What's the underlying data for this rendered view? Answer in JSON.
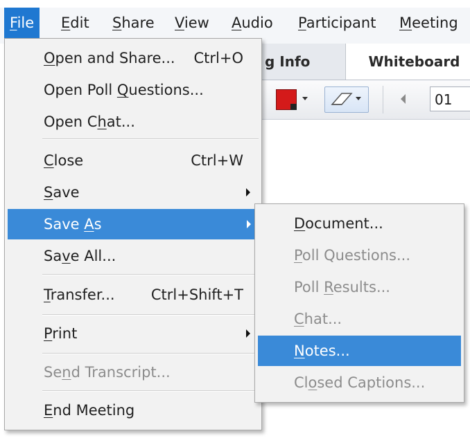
{
  "menubar": {
    "items": [
      {
        "pre": "",
        "u": "F",
        "post": "ile"
      },
      {
        "pre": "",
        "u": "E",
        "post": "dit"
      },
      {
        "pre": "",
        "u": "S",
        "post": "hare"
      },
      {
        "pre": "",
        "u": "V",
        "post": "iew"
      },
      {
        "pre": "",
        "u": "A",
        "post": "udio"
      },
      {
        "pre": "",
        "u": "P",
        "post": "articipant"
      },
      {
        "pre": "",
        "u": "M",
        "post": "eeting"
      }
    ]
  },
  "tabs": {
    "meeting_info": "g Info",
    "whiteboard": "Whiteboard"
  },
  "toolbar": {
    "page_value": "01"
  },
  "file_menu": {
    "open_share": {
      "pre": "",
      "u": "O",
      "post": "pen and Share...",
      "shortcut": "Ctrl+O"
    },
    "open_poll": {
      "pre": "Open Poll ",
      "u": "Q",
      "post": "uestions..."
    },
    "open_chat": {
      "pre": "Open C",
      "u": "h",
      "post": "at..."
    },
    "close": {
      "pre": "",
      "u": "C",
      "post": "lose",
      "shortcut": "Ctrl+W"
    },
    "save": {
      "pre": "",
      "u": "S",
      "post": "ave"
    },
    "save_as": {
      "pre": "Save ",
      "u": "A",
      "post": "s"
    },
    "save_all": {
      "pre": "Sa",
      "u": "v",
      "post": "e All..."
    },
    "transfer": {
      "pre": "",
      "u": "T",
      "post": "ransfer...",
      "shortcut": "Ctrl+Shift+T"
    },
    "print": {
      "pre": "",
      "u": "P",
      "post": "rint"
    },
    "send_transcript": {
      "pre": "Se",
      "u": "n",
      "post": "d Transcript..."
    },
    "end_meeting": {
      "pre": "",
      "u": "E",
      "post": "nd Meeting"
    }
  },
  "save_as_menu": {
    "document": {
      "pre": "",
      "u": "D",
      "post": "ocument..."
    },
    "poll_questions": {
      "pre": "",
      "u": "P",
      "post": "oll Questions..."
    },
    "poll_results": {
      "pre": "Poll ",
      "u": "R",
      "post": "esults..."
    },
    "chat": {
      "pre": "",
      "u": "C",
      "post": "hat..."
    },
    "notes": {
      "pre": "",
      "u": "N",
      "post": "otes..."
    },
    "closed_captions": {
      "pre": "Cl",
      "u": "o",
      "post": "sed Captions..."
    }
  },
  "colors": {
    "menu_highlight": "#3a8ad8",
    "menubar_active": "#1f78d1",
    "pen_color": "#d41a1a",
    "disabled_text": "#8c8c8c"
  },
  "icons": {
    "color_picker": "pen-color-icon",
    "eraser": "eraser-icon",
    "previous_page": "previous-page-icon"
  }
}
